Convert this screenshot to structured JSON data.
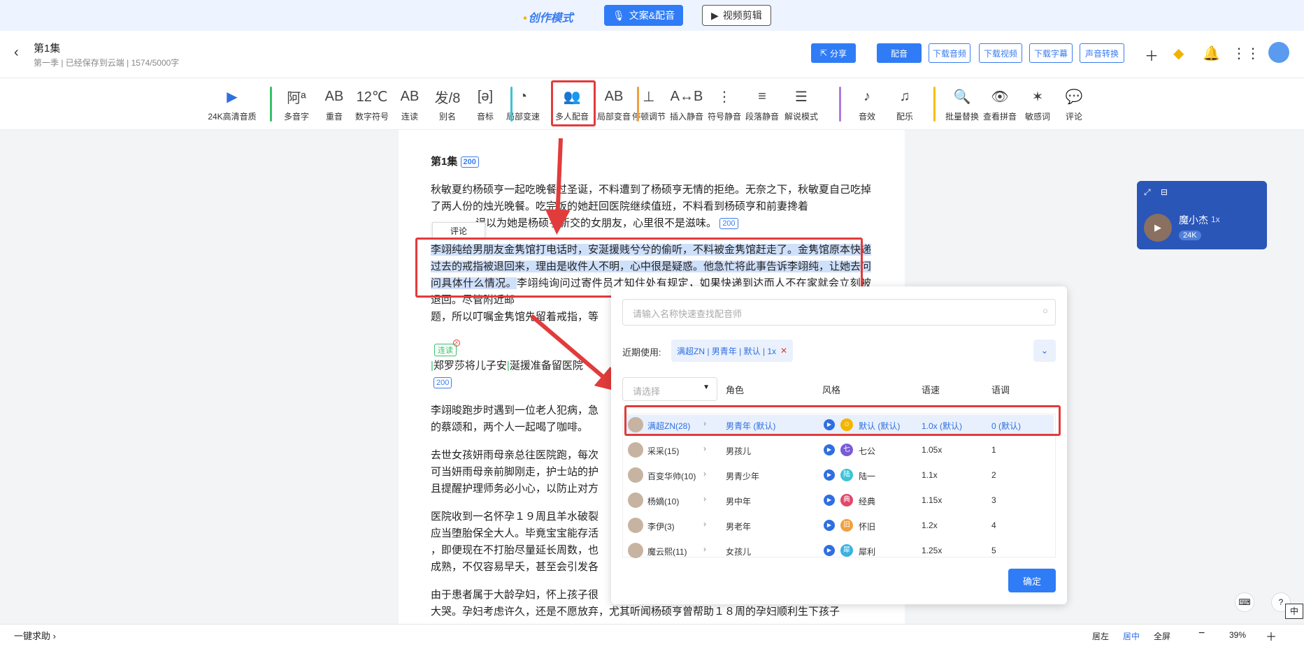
{
  "topbar": {
    "mode_label": "创作模式",
    "tab_copy": "文案&配音",
    "tab_video": "视频剪辑"
  },
  "header": {
    "title": "第1集",
    "subtitle": "第一季 | 已经保存到云端 | 1574/5000字",
    "share": "分享",
    "dub": "配音",
    "dl_audio": "下载音频",
    "dl_video": "下载视频",
    "dl_subtitle": "下载字幕",
    "voice_convert": "声音转换"
  },
  "tools": [
    "24K高清音质",
    "多音字",
    "重音",
    "数字符号",
    "连读",
    "别名",
    "音标",
    "局部变速",
    "多人配音",
    "局部变音",
    "停顿调节",
    "插入静音",
    "符号静音",
    "段落静音",
    "解说模式",
    "音效",
    "配乐",
    "批量替换",
    "查看拼音",
    "敏感词",
    "评论"
  ],
  "tool_icons": [
    "▶",
    "阿ª",
    "AB",
    "12℃",
    "AB",
    "发/8",
    "[ə]",
    "◔",
    "👥",
    "AB",
    "⊥",
    "A↔B",
    "⋮",
    "≡",
    "☰",
    "♪",
    "♫",
    "🔍",
    "👁",
    "✶",
    "💬"
  ],
  "editor": {
    "heading": "第1集",
    "heading_badge": "200",
    "p1": "秋敏夏约杨硕亨一起吃晚餐过圣诞，不料遭到了杨硕亨无情的拒绝。无奈之下，秋敏夏自己吃掉了两人份的烛光晚餐。吃完饭的她赶回医院继续值班，不料看到杨硕亨和前妻搀着",
    "p1b": "误以为她是杨硕亨新交的女朋友，心里很不是滋味。",
    "p1_badge": "200",
    "comment_tip": "评论",
    "p2_sel": "李翊纯给男朋友金隽馆打电话时，安涎援贱兮兮的偷听，不料被金隽馆赶走了。金隽馆原本快递过去的戒指被退回来，理由是收件人不明，心中很是疑惑。他急忙将此事告诉李翊纯，让她去问问具体什么情况。",
    "p2_rest": "李翊纯询问过寄件员才知住处有规定，如果快递到达而人不在家就会立刻被退回。尽管附近邮",
    "p2_line4": "题，所以叮嘱金隽馆先留着戒指，等",
    "lian_tag": "连读",
    "p3": "郑罗莎将儿子安",
    "p3b": "涎援准备留",
    "p3c": "医院",
    "p3_badge": "200",
    "p4a": "李翊晙跑步时遇到一位老人犯病，急",
    "p4b": "的蔡颂和，两个人一起喝了咖啡。",
    "p5a": "去世女孩妍雨母亲总往医院跑，每次",
    "p5b": "可当妍雨母亲前脚刚走，护士站的护",
    "p5c": "且提醒护理师务必小心，以防止对方",
    "p6a": "医院收到一名怀孕１９周且羊水破裂",
    "p6b": "应当堕胎保全大人。毕竟宝宝能存活",
    "p6c": "，即便现在不打胎尽量延长周数，也",
    "p6d": "成熟，不仅容易早夭，甚至会引发各",
    "p7a": "由于患者属于大龄孕妇，怀上孩子很",
    "p7b": "大哭。孕妇考虑许久，还是不愿放弃，尤其听闻杨硕亨曾帮助１８周的孕妇顺利生下孩子"
  },
  "panel": {
    "search_placeholder": "请输入名称快速查找配音师",
    "recent_label": "近期使用:",
    "recent_chip": "满超ZN | 男青年 | 默认 | 1x",
    "select_placeholder": "请选择",
    "col_role": "角色",
    "col_style": "风格",
    "col_speed": "语速",
    "col_tone": "语调",
    "speakers": [
      "满超ZN(28)",
      "采采(15)",
      "百变华帅(10)",
      "杨嫡(10)",
      "李伊(3)",
      "魔云熙(11)"
    ],
    "roles": [
      "男青年 (默认)",
      "男孩儿",
      "男青少年",
      "男中年",
      "男老年",
      "女孩儿"
    ],
    "styles": [
      "默认 (默认)",
      "七公",
      "陆一",
      "经典",
      "怀旧",
      "犀利"
    ],
    "style_icons": [
      "☺",
      "七",
      "陆",
      "典",
      "旧",
      "犀"
    ],
    "style_colors": [
      "#f5b400",
      "#7a5ad8",
      "#3cc3d8",
      "#e0476b",
      "#f0a040",
      "#3cb0e0"
    ],
    "speeds": [
      "1.0x (默认)",
      "1.05x",
      "1.1x",
      "1.15x",
      "1.2x",
      "1.25x"
    ],
    "tones": [
      "0 (默认)",
      "1",
      "2",
      "3",
      "4",
      "5"
    ],
    "confirm": "确定"
  },
  "speaker_card": {
    "name": "魔小杰",
    "speed": "1x",
    "quality": "24K"
  },
  "bottom": {
    "help": "一键求助",
    "align_left": "居左",
    "align_center": "居中",
    "fullscreen": "全屏",
    "zoom": "39%",
    "ime": "中"
  }
}
